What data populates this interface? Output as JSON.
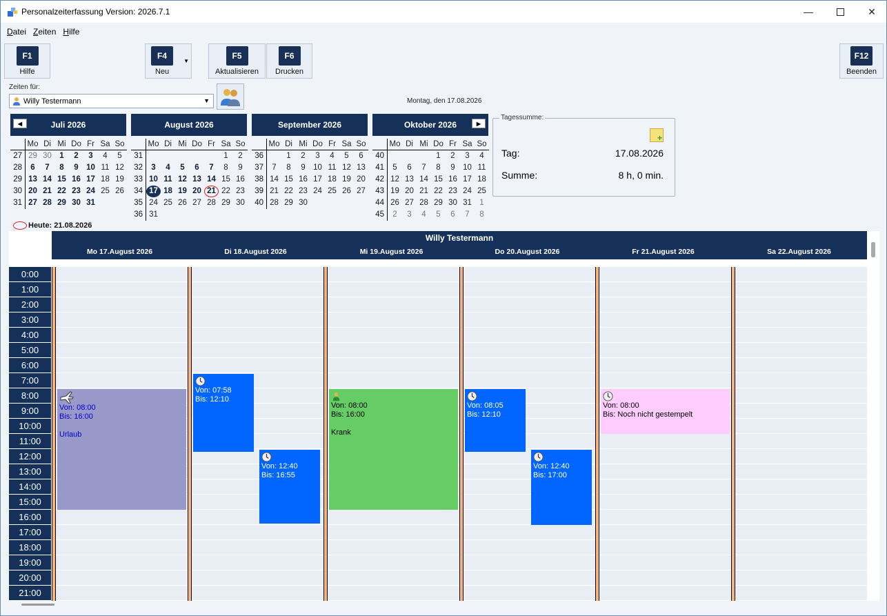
{
  "window": {
    "title": "Personalzeiterfassung Version: 2026.7.1"
  },
  "menu": [
    "Datei",
    "Zeiten",
    "Hilfe"
  ],
  "toolbar": {
    "help": {
      "key": "F1",
      "label": "Hilfe"
    },
    "new": {
      "key": "F4",
      "label": "Neu"
    },
    "refresh": {
      "key": "F5",
      "label": "Aktualisieren"
    },
    "print": {
      "key": "F6",
      "label": "Drucken"
    },
    "quit": {
      "key": "F12",
      "label": "Beenden"
    }
  },
  "user": {
    "label": "Zeiten für:",
    "selected": "Willy Testermann"
  },
  "date_label": "Montag, den 17.08.2026",
  "weekday_headers": [
    "Mo",
    "Di",
    "Mi",
    "Do",
    "Fr",
    "Sa",
    "So"
  ],
  "calendars": [
    {
      "title": "Juli 2026",
      "rows": [
        [
          "27",
          "29",
          "30",
          "1",
          "2",
          "3",
          "4",
          "5"
        ],
        [
          "28",
          "6",
          "7",
          "8",
          "9",
          "10",
          "11",
          "12"
        ],
        [
          "29",
          "13",
          "14",
          "15",
          "16",
          "17",
          "18",
          "19"
        ],
        [
          "30",
          "20",
          "21",
          "22",
          "23",
          "24",
          "25",
          "26"
        ],
        [
          "31",
          "27",
          "28",
          "29",
          "30",
          "31",
          "",
          ""
        ]
      ]
    },
    {
      "title": "August 2026",
      "rows": [
        [
          "31",
          "",
          "",
          "",
          "",
          "",
          "1",
          "2"
        ],
        [
          "32",
          "3",
          "4",
          "5",
          "6",
          "7",
          "8",
          "9"
        ],
        [
          "33",
          "10",
          "11",
          "12",
          "13",
          "14",
          "15",
          "16"
        ],
        [
          "34",
          "17",
          "18",
          "19",
          "20",
          "21",
          "22",
          "23"
        ],
        [
          "35",
          "24",
          "25",
          "26",
          "27",
          "28",
          "29",
          "30"
        ],
        [
          "36",
          "31",
          "",
          "",
          "",
          "",
          "",
          ""
        ]
      ]
    },
    {
      "title": "September 2026",
      "rows": [
        [
          "36",
          "",
          "1",
          "2",
          "3",
          "4",
          "5",
          "6"
        ],
        [
          "37",
          "7",
          "8",
          "9",
          "10",
          "11",
          "12",
          "13"
        ],
        [
          "38",
          "14",
          "15",
          "16",
          "17",
          "18",
          "19",
          "20"
        ],
        [
          "39",
          "21",
          "22",
          "23",
          "24",
          "25",
          "26",
          "27"
        ],
        [
          "40",
          "28",
          "29",
          "30",
          "",
          "",
          "",
          ""
        ]
      ]
    },
    {
      "title": "Oktober 2026",
      "rows": [
        [
          "40",
          "",
          "",
          "",
          "1",
          "2",
          "3",
          "4"
        ],
        [
          "41",
          "5",
          "6",
          "7",
          "8",
          "9",
          "10",
          "11"
        ],
        [
          "42",
          "12",
          "13",
          "14",
          "15",
          "16",
          "17",
          "18"
        ],
        [
          "43",
          "19",
          "20",
          "21",
          "22",
          "23",
          "24",
          "25"
        ],
        [
          "44",
          "26",
          "27",
          "28",
          "29",
          "30",
          "31",
          "1"
        ],
        [
          "45",
          "2",
          "3",
          "4",
          "5",
          "6",
          "7",
          "8"
        ]
      ]
    }
  ],
  "tagessumme": {
    "legend": "Tagessumme:",
    "tag_label": "Tag:",
    "tag_value": "17.08.2026",
    "summe_label": "Summe:",
    "summe_value": "8 h, 0 min."
  },
  "today": "Heute: 21.08.2026",
  "schedule": {
    "person": "Willy Testermann",
    "days": [
      "Mo 17.August 2026",
      "Di 18.August 2026",
      "Mi 19.August 2026",
      "Do 20.August 2026",
      "Fr 21.August 2026",
      "Sa 22.August 2026"
    ],
    "hours": [
      "0:00",
      "1:00",
      "2:00",
      "3:00",
      "4:00",
      "5:00",
      "6:00",
      "7:00",
      "8:00",
      "9:00",
      "10:00",
      "11:00",
      "12:00",
      "13:00",
      "14:00",
      "15:00",
      "16:00",
      "17:00",
      "18:00",
      "19:00",
      "20:00",
      "21:00"
    ],
    "events": [
      {
        "day": 0,
        "start": 8.0,
        "end": 16.0,
        "sub": 0,
        "color": "#9999c9",
        "textcolor": "#0000cc",
        "icon": "plane-icon",
        "von": "Von: 08:00",
        "bis": "Bis: 16:00",
        "note": "Urlaub"
      },
      {
        "day": 1,
        "start": 7.0,
        "end": 12.17,
        "sub": 0,
        "color": "#0066ff",
        "textcolor": "#ffffff",
        "icon": "clock-icon",
        "von": "Von: 07:58",
        "bis": "Bis: 12:10",
        "note": ""
      },
      {
        "day": 1,
        "start": 12.0,
        "end": 16.92,
        "sub": 1,
        "color": "#0066ff",
        "textcolor": "#ffffff",
        "icon": "clock-icon",
        "von": "Von: 12:40",
        "bis": "Bis: 16:55",
        "note": ""
      },
      {
        "day": 2,
        "start": 8.0,
        "end": 16.0,
        "sub": 0,
        "color": "#66cc66",
        "textcolor": "#000000",
        "icon": "person-icon",
        "von": "Von: 08:00",
        "bis": "Bis: 16:00",
        "note": "Krank"
      },
      {
        "day": 3,
        "start": 8.0,
        "end": 12.17,
        "sub": 0,
        "color": "#0066ff",
        "textcolor": "#ffffff",
        "icon": "clock-icon",
        "von": "Von: 08:05",
        "bis": "Bis: 12:10",
        "note": ""
      },
      {
        "day": 3,
        "start": 12.0,
        "end": 17.0,
        "sub": 1,
        "color": "#0066ff",
        "textcolor": "#ffffff",
        "icon": "clock-icon",
        "von": "Von: 12:40",
        "bis": "Bis: 17:00",
        "note": ""
      },
      {
        "day": 4,
        "start": 8.0,
        "end": 11.0,
        "sub": 0,
        "color": "#ffccff",
        "textcolor": "#000000",
        "icon": "clock-icon",
        "von": "Von: 08:00",
        "bis": "Bis: Noch nicht gestempelt",
        "note": ""
      }
    ]
  }
}
